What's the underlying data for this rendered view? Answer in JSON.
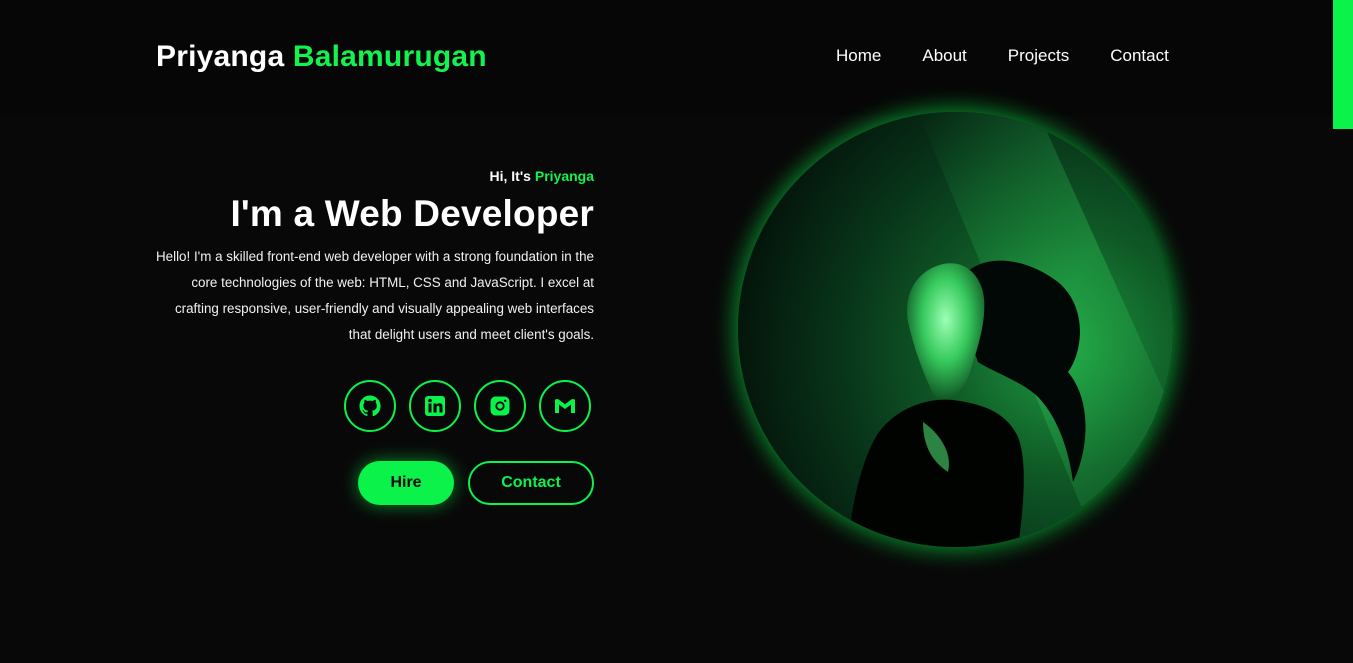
{
  "header": {
    "logo_first": "Priyanga",
    "logo_last": "Balamurugan",
    "nav": [
      {
        "label": "Home"
      },
      {
        "label": "About"
      },
      {
        "label": "Projects"
      },
      {
        "label": "Contact"
      }
    ]
  },
  "intro": {
    "greeting_prefix": "Hi, It's",
    "greeting_name": "Priyanga",
    "headline": "I'm a Web Developer",
    "bio": "Hello! I'm a skilled front-end web developer with a strong foundation in the core technologies of the web: HTML, CSS and JavaScript. I excel at crafting responsive, user-friendly and visually appealing web interfaces that delight users and meet client's goals."
  },
  "socials": [
    {
      "icon": "github-icon"
    },
    {
      "icon": "linkedin-icon"
    },
    {
      "icon": "instagram-icon"
    },
    {
      "icon": "gmail-icon"
    }
  ],
  "buttons": {
    "hire": "Hire",
    "contact": "Contact"
  },
  "colors": {
    "accent": "#0bf24a",
    "background": "#080808"
  }
}
